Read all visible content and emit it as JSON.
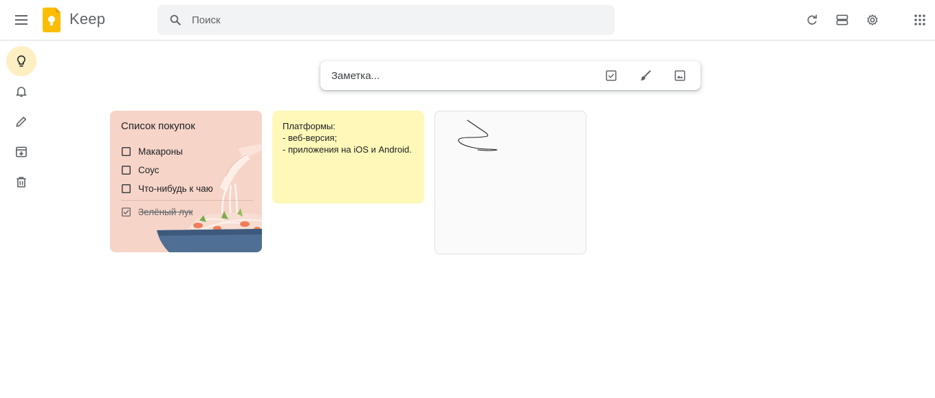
{
  "header": {
    "app_name": "Keep",
    "search_placeholder": "Поиск"
  },
  "sidebar": {
    "items": [
      {
        "name": "notes",
        "icon": "lightbulb-icon",
        "active": true
      },
      {
        "name": "reminders",
        "icon": "bell-icon",
        "active": false
      },
      {
        "name": "edit-labels",
        "icon": "pencil-icon",
        "active": false
      },
      {
        "name": "archive",
        "icon": "archive-icon",
        "active": false
      },
      {
        "name": "trash",
        "icon": "trash-icon",
        "active": false
      }
    ]
  },
  "take_note": {
    "placeholder": "Заметка..."
  },
  "notes": {
    "shopping": {
      "title": "Список покупок",
      "items": [
        {
          "label": "Макароны",
          "checked": false
        },
        {
          "label": "Соус",
          "checked": false
        },
        {
          "label": "Что-нибудь к чаю",
          "checked": false
        },
        {
          "label": "Зелёный лук",
          "checked": true
        }
      ],
      "color": "#f6d4c8"
    },
    "platforms": {
      "lines": [
        "Платформы:",
        "- веб-версия;",
        "- приложения на iOS и Android."
      ],
      "color": "#fff8b8"
    },
    "drawing": {
      "color": "#fafafa"
    }
  },
  "colors": {
    "accent_active": "#feefc3",
    "logo_yellow": "#fbbc04",
    "icon_gray": "#5f6368"
  }
}
